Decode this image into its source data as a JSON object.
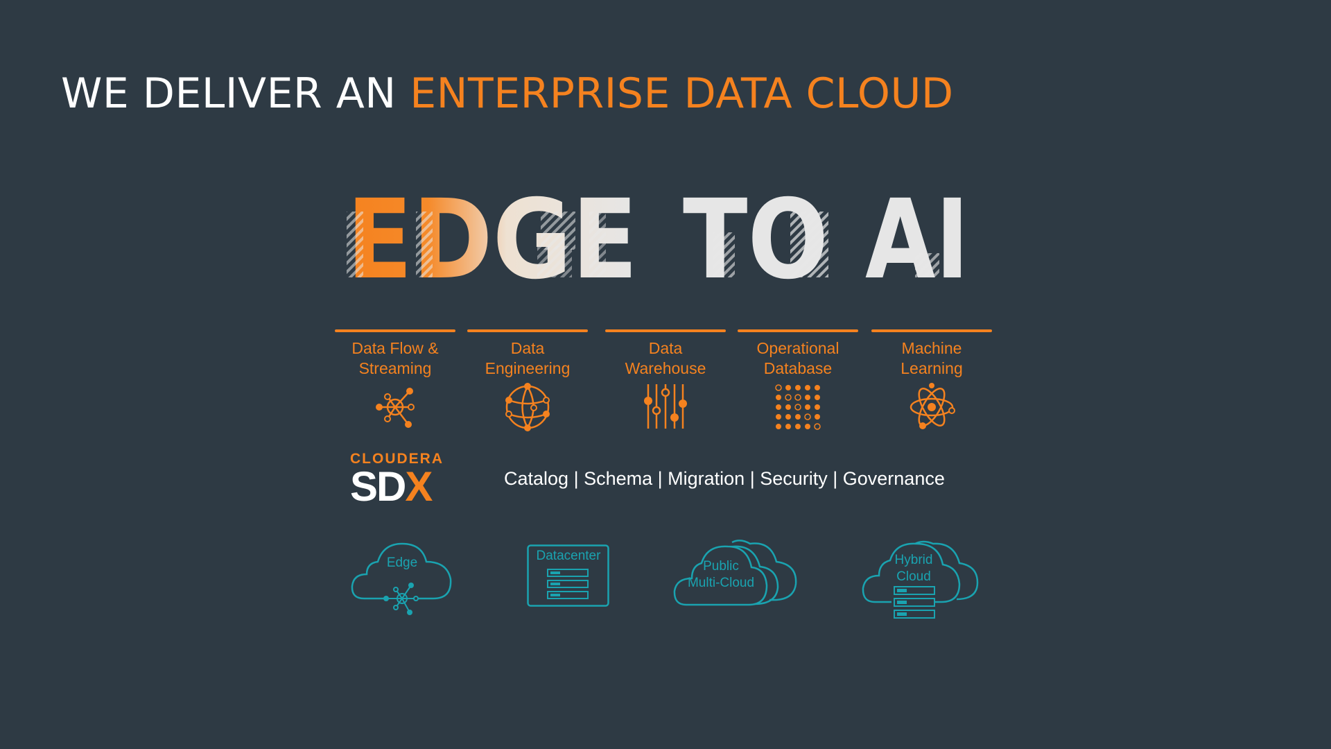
{
  "title": {
    "white": "WE DELIVER AN",
    "orange": "ENTERPRISE DATA CLOUD"
  },
  "hero": {
    "word1": "EDGE",
    "word2": "TO",
    "word3": "AI"
  },
  "categories": [
    {
      "label": "Data Flow &\nStreaming",
      "icon": "network-node-icon"
    },
    {
      "label": "Data\nEngineering",
      "icon": "globe-network-icon"
    },
    {
      "label": "Data\nWarehouse",
      "icon": "sliders-icon"
    },
    {
      "label": "Operational\nDatabase",
      "icon": "dot-grid-icon"
    },
    {
      "label": "Machine\nLearning",
      "icon": "atom-icon"
    }
  ],
  "sdx": {
    "brand": "CLOUDERA",
    "name_main": "SD",
    "name_accent": "X",
    "features": "Catalog | Schema | Migration | Security | Governance"
  },
  "environments": [
    {
      "label": "Edge",
      "icon": "edge-cloud-icon"
    },
    {
      "label": "Datacenter",
      "icon": "datacenter-icon"
    },
    {
      "label": "Public\nMulti-Cloud",
      "icon": "multi-cloud-icon"
    },
    {
      "label": "Hybrid\nCloud",
      "icon": "hybrid-cloud-icon"
    }
  ],
  "colors": {
    "background": "#2e3a44",
    "accent": "#f5821f",
    "teal": "#1aa3b0",
    "white": "#ffffff"
  }
}
